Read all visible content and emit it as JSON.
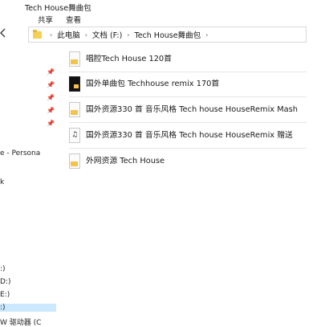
{
  "window": {
    "title": "Tech House舞曲包"
  },
  "ribbon": {
    "tabs": [
      "共享",
      "查看"
    ]
  },
  "address": {
    "crumbs": [
      "此电脑",
      "文档 (F:)",
      "Tech House舞曲包"
    ]
  },
  "sidebar": {
    "items": [
      {
        "label": "e - Persona"
      },
      {
        "label": "k"
      },
      {
        "label": ":)"
      },
      {
        "label": "D:)"
      },
      {
        "label": "E:)"
      },
      {
        "label": ":)"
      },
      {
        "label": "W 驱动器 (C"
      }
    ]
  },
  "files": [
    {
      "name": "唱腔Tech House 120首",
      "icon": "folder-file-icon"
    },
    {
      "name": "国外单曲包 Techhouse remix 170首",
      "icon": "dark-folder-file-icon"
    },
    {
      "name": "国外资源330 首 音乐风格 Tech house HouseRemix Mash",
      "icon": "folder-file-icon"
    },
    {
      "name": "国外资源330 首 音乐风格 Tech house HouseRemix 赠送",
      "icon": "music-file-icon"
    },
    {
      "name": "外网资源 Tech House",
      "icon": "folder-file-icon"
    }
  ]
}
